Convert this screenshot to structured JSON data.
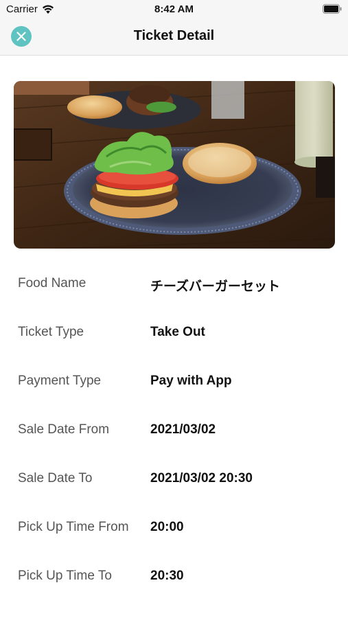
{
  "status_bar": {
    "carrier": "Carrier",
    "time": "8:42 AM",
    "wifi_icon": "wifi-icon",
    "battery_icon": "battery-icon"
  },
  "nav": {
    "title": "Ticket Detail",
    "close_icon": "close-icon",
    "accent_color": "#5fc3c1"
  },
  "photo": {
    "description_icon": "food-photo"
  },
  "details": [
    {
      "label": "Food Name",
      "value": "チーズバーガーセット"
    },
    {
      "label": "Ticket Type",
      "value": "Take Out"
    },
    {
      "label": "Payment Type",
      "value": "Pay with App"
    },
    {
      "label": "Sale Date From",
      "value": "2021/03/02"
    },
    {
      "label": "Sale Date To",
      "value": "2021/03/02 20:30"
    },
    {
      "label": "Pick Up Time From",
      "value": "20:00"
    },
    {
      "label": "Pick Up Time To",
      "value": "20:30"
    }
  ]
}
